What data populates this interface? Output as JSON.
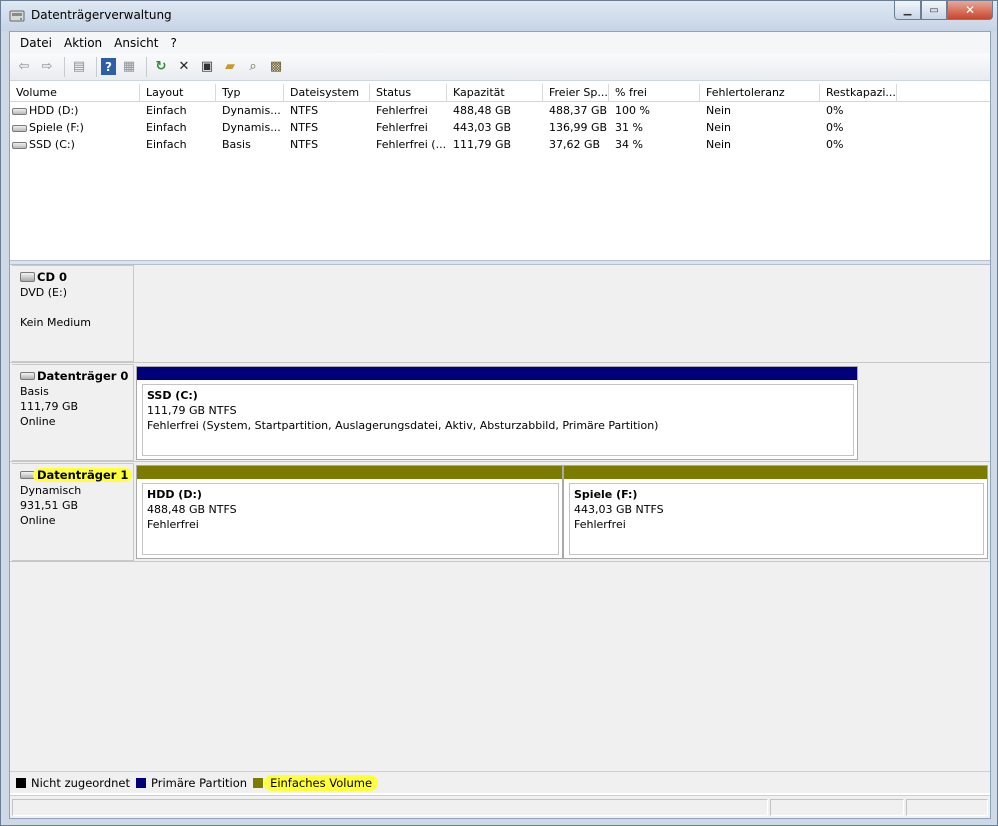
{
  "window": {
    "title": "Datenträgerverwaltung"
  },
  "menu": [
    "Datei",
    "Aktion",
    "Ansicht",
    "?"
  ],
  "volume_list": {
    "columns": [
      "Volume",
      "Layout",
      "Typ",
      "Dateisystem",
      "Status",
      "Kapazität",
      "Freier Sp...",
      "% frei",
      "Fehlertoleranz",
      "Restkapazi..."
    ],
    "rows": [
      [
        "HDD (D:)",
        "Einfach",
        "Dynamis...",
        "NTFS",
        "Fehlerfrei",
        "488,48 GB",
        "488,37 GB",
        "100 %",
        "Nein",
        "0%"
      ],
      [
        "Spiele (F:)",
        "Einfach",
        "Dynamis...",
        "NTFS",
        "Fehlerfrei",
        "443,03 GB",
        "136,99 GB",
        "31 %",
        "Nein",
        "0%"
      ],
      [
        "SSD (C:)",
        "Einfach",
        "Basis",
        "NTFS",
        "Fehlerfrei (...",
        "111,79 GB",
        "37,62 GB",
        "34 %",
        "Nein",
        "0%"
      ]
    ]
  },
  "disks": {
    "cd0": {
      "name": "CD 0",
      "line1": "DVD (E:)",
      "line2": "",
      "line3": "Kein Medium"
    },
    "disk0": {
      "name": "Datenträger 0",
      "line1": "Basis",
      "line2": "111,79 GB",
      "line3": "Online"
    },
    "disk1": {
      "name": "Datenträger 1",
      "line1": "Dynamisch",
      "line2": "931,51 GB",
      "line3": "Online"
    }
  },
  "partitions": {
    "ssd": {
      "name": "SSD  (C:)",
      "size": "111,79 GB NTFS",
      "status": "Fehlerfrei (System, Startpartition, Auslagerungsdatei, Aktiv, Absturzabbild, Primäre Partition)",
      "color": "#00007b"
    },
    "hdd": {
      "name": "HDD  (D:)",
      "size": "488,48 GB NTFS",
      "status": "Fehlerfrei",
      "color": "#7b7b00"
    },
    "spiele": {
      "name": "Spiele  (F:)",
      "size": "443,03 GB NTFS",
      "status": "Fehlerfrei",
      "color": "#7b7b00"
    }
  },
  "legend": [
    {
      "label": "Nicht zugeordnet",
      "color": "#000000"
    },
    {
      "label": "Primäre Partition",
      "color": "#00007b"
    },
    {
      "label": "Einfaches Volume",
      "color": "#7b7b00"
    }
  ],
  "colors": {
    "highlight": "#ffff3a"
  }
}
